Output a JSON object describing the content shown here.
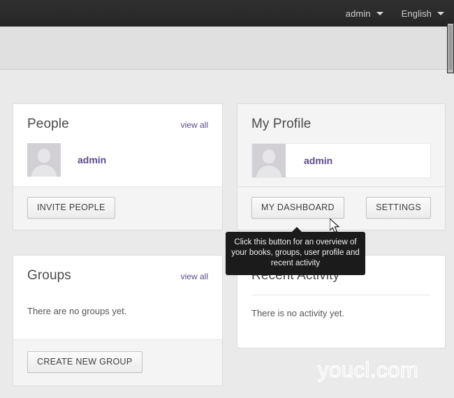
{
  "topbar": {
    "user_menu": {
      "label": "admin",
      "icon": "chevron-down-icon"
    },
    "language_menu": {
      "label": "English",
      "icon": "chevron-down-icon"
    }
  },
  "people_card": {
    "title": "People",
    "view_all": "view all",
    "member": {
      "name": "admin",
      "avatar": "user-placeholder-avatar"
    },
    "invite_button": "INVITE PEOPLE"
  },
  "profile_card": {
    "title": "My Profile",
    "user": {
      "name": "admin",
      "avatar": "user-placeholder-avatar"
    },
    "dashboard_button": "MY DASHBOARD",
    "settings_button": "SETTINGS"
  },
  "groups_card": {
    "title": "Groups",
    "view_all": "view all",
    "empty_text": "There are no groups yet.",
    "create_button": "CREATE NEW GROUP"
  },
  "activity_card": {
    "title": "Recent Activity",
    "empty_text": "There is no activity yet."
  },
  "tooltip": {
    "text": "Click this button for an overview of your books, groups, user profile and recent activity"
  },
  "watermark": {
    "text": "youcl.com"
  },
  "colors": {
    "topbar_bg": "#2b2b2b",
    "page_bg": "#eaeaea",
    "link_purple": "#5b4a8c",
    "card_border": "#dcdcdc",
    "tooltip_bg": "#1b1b1b"
  }
}
